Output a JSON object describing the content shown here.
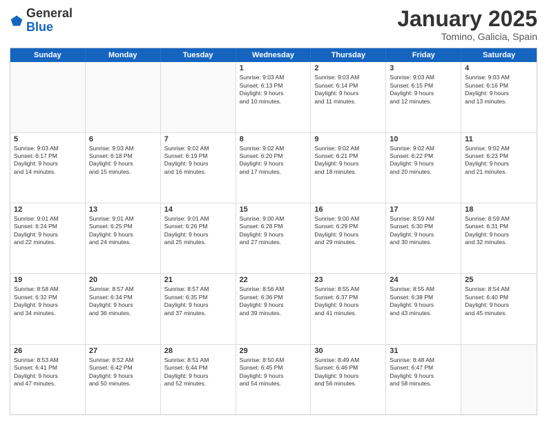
{
  "header": {
    "logo_general": "General",
    "logo_blue": "Blue",
    "month_title": "January 2025",
    "location": "Tomino, Galicia, Spain"
  },
  "days_of_week": [
    "Sunday",
    "Monday",
    "Tuesday",
    "Wednesday",
    "Thursday",
    "Friday",
    "Saturday"
  ],
  "weeks": [
    [
      {
        "day": "",
        "text": ""
      },
      {
        "day": "",
        "text": ""
      },
      {
        "day": "",
        "text": ""
      },
      {
        "day": "1",
        "text": "Sunrise: 9:03 AM\nSunset: 6:13 PM\nDaylight: 9 hours\nand 10 minutes."
      },
      {
        "day": "2",
        "text": "Sunrise: 9:03 AM\nSunset: 6:14 PM\nDaylight: 9 hours\nand 11 minutes."
      },
      {
        "day": "3",
        "text": "Sunrise: 9:03 AM\nSunset: 6:15 PM\nDaylight: 9 hours\nand 12 minutes."
      },
      {
        "day": "4",
        "text": "Sunrise: 9:03 AM\nSunset: 6:16 PM\nDaylight: 9 hours\nand 13 minutes."
      }
    ],
    [
      {
        "day": "5",
        "text": "Sunrise: 9:03 AM\nSunset: 6:17 PM\nDaylight: 9 hours\nand 14 minutes."
      },
      {
        "day": "6",
        "text": "Sunrise: 9:03 AM\nSunset: 6:18 PM\nDaylight: 9 hours\nand 15 minutes."
      },
      {
        "day": "7",
        "text": "Sunrise: 9:02 AM\nSunset: 6:19 PM\nDaylight: 9 hours\nand 16 minutes."
      },
      {
        "day": "8",
        "text": "Sunrise: 9:02 AM\nSunset: 6:20 PM\nDaylight: 9 hours\nand 17 minutes."
      },
      {
        "day": "9",
        "text": "Sunrise: 9:02 AM\nSunset: 6:21 PM\nDaylight: 9 hours\nand 18 minutes."
      },
      {
        "day": "10",
        "text": "Sunrise: 9:02 AM\nSunset: 6:22 PM\nDaylight: 9 hours\nand 20 minutes."
      },
      {
        "day": "11",
        "text": "Sunrise: 9:02 AM\nSunset: 6:23 PM\nDaylight: 9 hours\nand 21 minutes."
      }
    ],
    [
      {
        "day": "12",
        "text": "Sunrise: 9:01 AM\nSunset: 6:24 PM\nDaylight: 9 hours\nand 22 minutes."
      },
      {
        "day": "13",
        "text": "Sunrise: 9:01 AM\nSunset: 6:25 PM\nDaylight: 9 hours\nand 24 minutes."
      },
      {
        "day": "14",
        "text": "Sunrise: 9:01 AM\nSunset: 6:26 PM\nDaylight: 9 hours\nand 25 minutes."
      },
      {
        "day": "15",
        "text": "Sunrise: 9:00 AM\nSunset: 6:28 PM\nDaylight: 9 hours\nand 27 minutes."
      },
      {
        "day": "16",
        "text": "Sunrise: 9:00 AM\nSunset: 6:29 PM\nDaylight: 9 hours\nand 29 minutes."
      },
      {
        "day": "17",
        "text": "Sunrise: 8:59 AM\nSunset: 6:30 PM\nDaylight: 9 hours\nand 30 minutes."
      },
      {
        "day": "18",
        "text": "Sunrise: 8:59 AM\nSunset: 6:31 PM\nDaylight: 9 hours\nand 32 minutes."
      }
    ],
    [
      {
        "day": "19",
        "text": "Sunrise: 8:58 AM\nSunset: 6:32 PM\nDaylight: 9 hours\nand 34 minutes."
      },
      {
        "day": "20",
        "text": "Sunrise: 8:57 AM\nSunset: 6:34 PM\nDaylight: 9 hours\nand 36 minutes."
      },
      {
        "day": "21",
        "text": "Sunrise: 8:57 AM\nSunset: 6:35 PM\nDaylight: 9 hours\nand 37 minutes."
      },
      {
        "day": "22",
        "text": "Sunrise: 8:56 AM\nSunset: 6:36 PM\nDaylight: 9 hours\nand 39 minutes."
      },
      {
        "day": "23",
        "text": "Sunrise: 8:55 AM\nSunset: 6:37 PM\nDaylight: 9 hours\nand 41 minutes."
      },
      {
        "day": "24",
        "text": "Sunrise: 8:55 AM\nSunset: 6:38 PM\nDaylight: 9 hours\nand 43 minutes."
      },
      {
        "day": "25",
        "text": "Sunrise: 8:54 AM\nSunset: 6:40 PM\nDaylight: 9 hours\nand 45 minutes."
      }
    ],
    [
      {
        "day": "26",
        "text": "Sunrise: 8:53 AM\nSunset: 6:41 PM\nDaylight: 9 hours\nand 47 minutes."
      },
      {
        "day": "27",
        "text": "Sunrise: 8:52 AM\nSunset: 6:42 PM\nDaylight: 9 hours\nand 50 minutes."
      },
      {
        "day": "28",
        "text": "Sunrise: 8:51 AM\nSunset: 6:44 PM\nDaylight: 9 hours\nand 52 minutes."
      },
      {
        "day": "29",
        "text": "Sunrise: 8:50 AM\nSunset: 6:45 PM\nDaylight: 9 hours\nand 54 minutes."
      },
      {
        "day": "30",
        "text": "Sunrise: 8:49 AM\nSunset: 6:46 PM\nDaylight: 9 hours\nand 56 minutes."
      },
      {
        "day": "31",
        "text": "Sunrise: 8:48 AM\nSunset: 6:47 PM\nDaylight: 9 hours\nand 58 minutes."
      },
      {
        "day": "",
        "text": ""
      }
    ]
  ]
}
